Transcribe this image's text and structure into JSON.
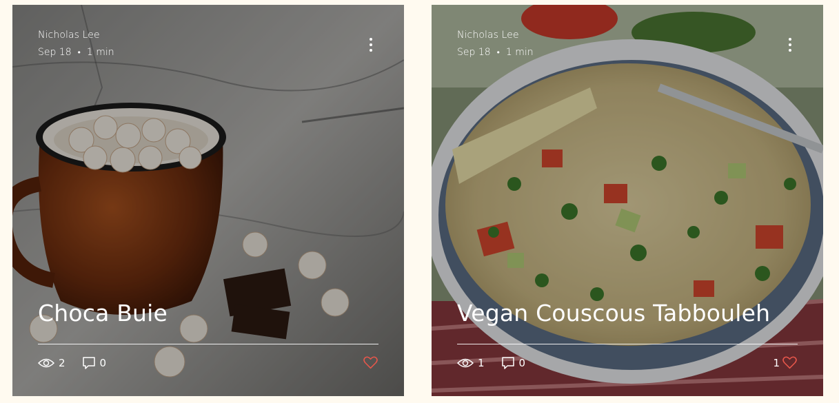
{
  "posts": [
    {
      "author": "Nicholas Lee",
      "date": "Sep 18",
      "read_time": "1 min",
      "separator": "•",
      "title": "Choca Buie",
      "views": "2",
      "comments": "0",
      "likes": "",
      "like_color": "#e8574b",
      "image_subject": "mug of hot chocolate with marshmallows on wooden table"
    },
    {
      "author": "Nicholas Lee",
      "date": "Sep 18",
      "read_time": "1 min",
      "separator": "•",
      "title": "Vegan Couscous Tabbouleh",
      "views": "1",
      "comments": "0",
      "likes": "1",
      "like_color": "#e8574b",
      "image_subject": "bowl of couscous tabbouleh salad with fork"
    }
  ],
  "icons": {
    "more": "more-vertical-icon",
    "views": "eye-icon",
    "comments": "comment-icon",
    "like": "heart-icon"
  }
}
